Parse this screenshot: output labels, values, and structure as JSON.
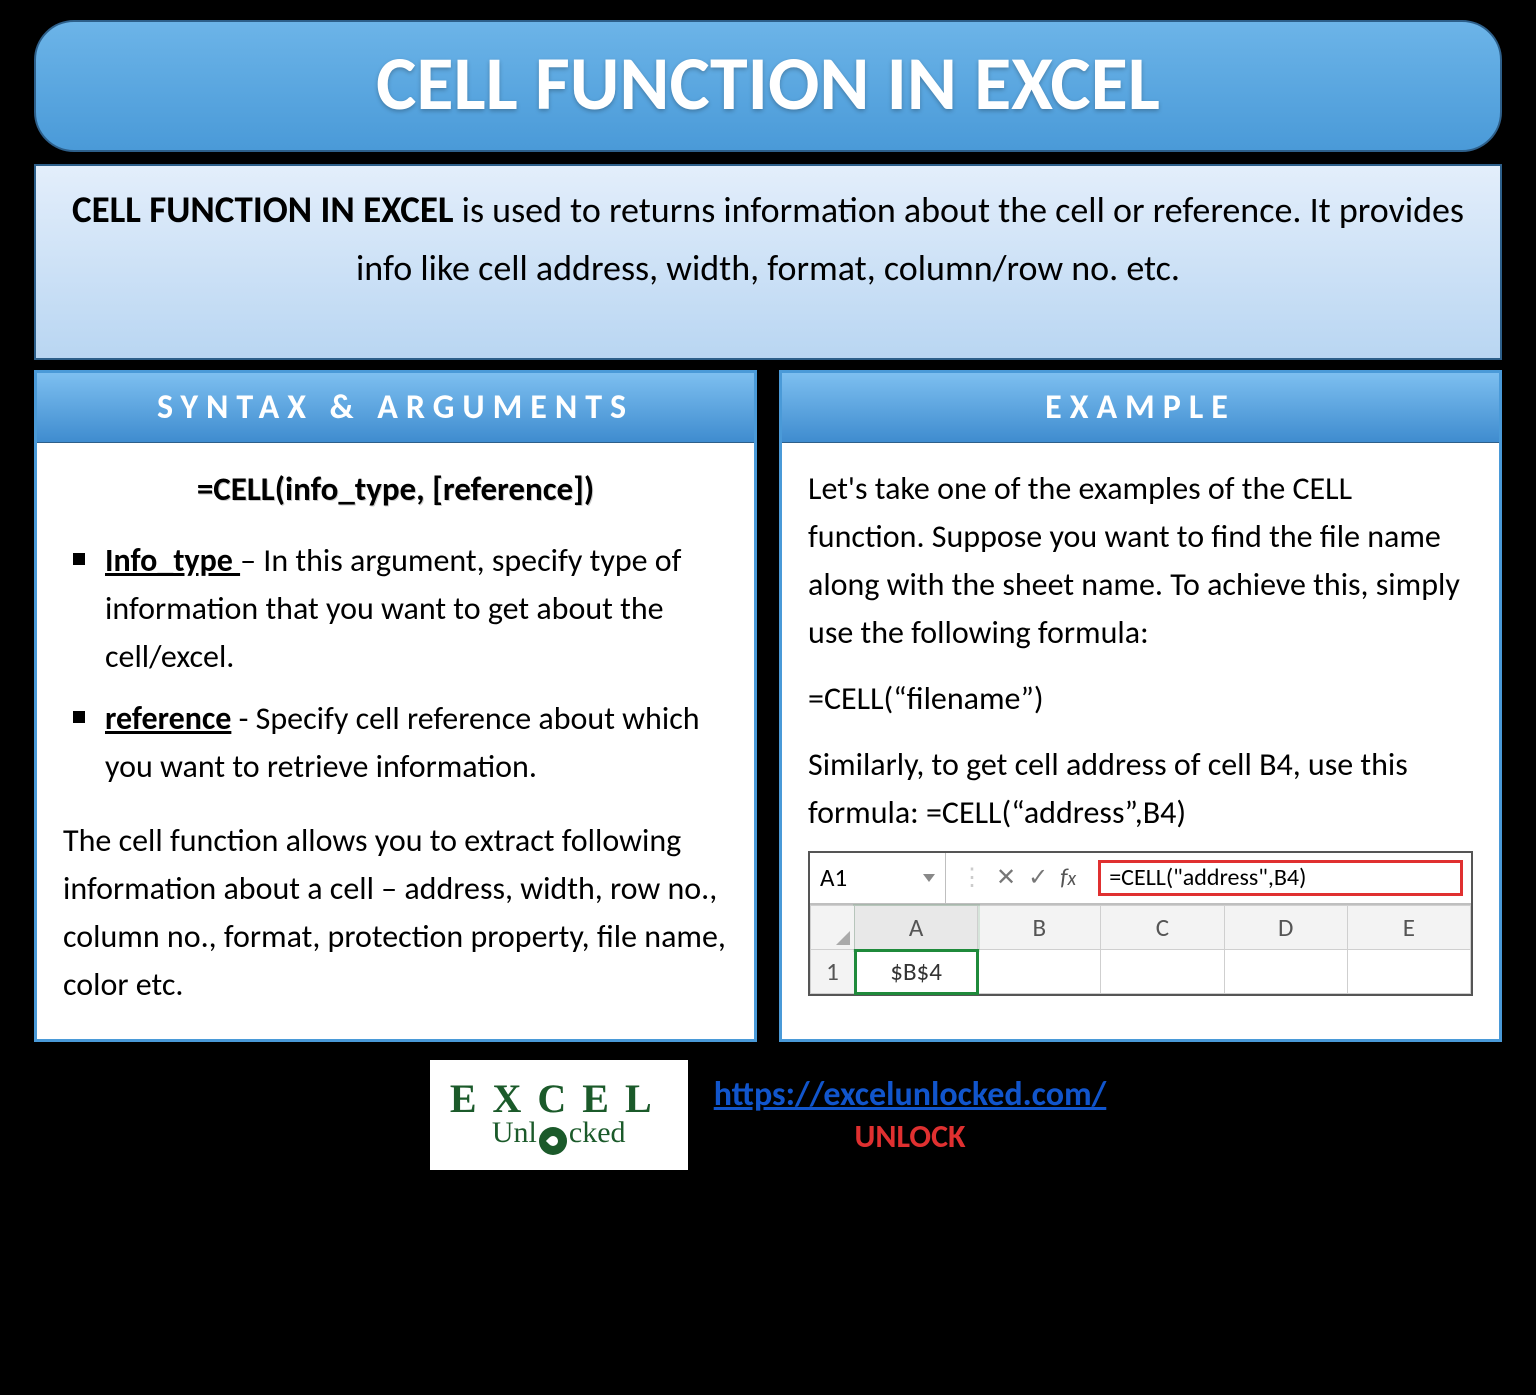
{
  "title": "CELL FUNCTION IN EXCEL",
  "description": {
    "lead": "CELL FUNCTION IN EXCEL",
    "rest": " is used to returns information about the cell or reference. It provides info like cell address, width, format, column/row no. etc."
  },
  "syntax": {
    "header": "SYNTAX & ARGUMENTS",
    "formula": "=CELL(info_type, [reference])",
    "args": [
      {
        "name": "Info_type ",
        "text": "– In this argument, specify type of information that you want to get about the cell/excel."
      },
      {
        "name": "reference",
        "text": " - Specify cell reference about which you want to retrieve information."
      }
    ],
    "note": "The cell function allows you to extract following information about a cell – address, width, row no., column no., format, protection property, file name, color etc."
  },
  "example": {
    "header": "EXAMPLE",
    "intro": "Let's take one of the examples of the CELL function. Suppose you want to find the file name along with the sheet name. To achieve this, simply use the following formula:",
    "formula1": "=CELL(“filename”)",
    "intro2": "Similarly, to get cell address of cell B4, use this formula: =CELL(“address”,B4)",
    "shot": {
      "namebox": "A1",
      "fbar": "=CELL(\"address\",B4)",
      "cols": [
        "A",
        "B",
        "C",
        "D",
        "E"
      ],
      "rows": [
        {
          "num": "1",
          "cells": [
            "$B$4",
            "",
            "",
            "",
            ""
          ]
        }
      ]
    }
  },
  "footer": {
    "logo_top": "EXCEL",
    "logo_bot_pre": "Unl",
    "logo_bot_post": "cked",
    "link": "https://excelunlocked.com/",
    "unlock": "UNLOCK"
  }
}
